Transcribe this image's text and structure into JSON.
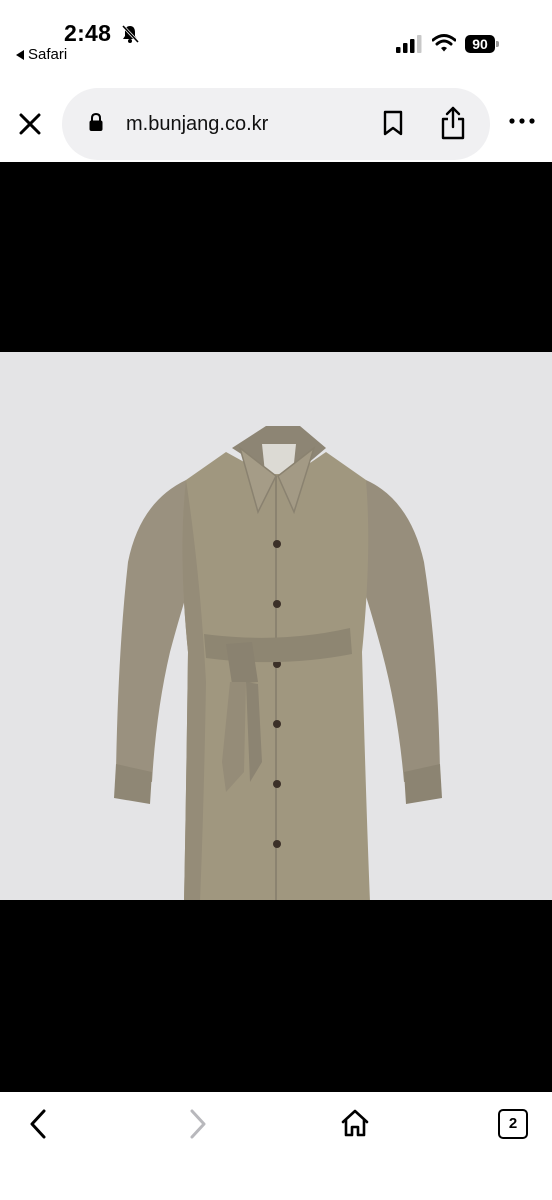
{
  "status_bar": {
    "time": "2:48",
    "back_app_label": "Safari",
    "battery_level": "90",
    "icons": [
      "bell-slash-icon",
      "signal-icon",
      "wifi-icon",
      "battery-icon"
    ]
  },
  "address_bar": {
    "url": "m.bunjang.co.kr",
    "icons": [
      "close-icon",
      "lock-icon",
      "bookmark-icon",
      "share-icon",
      "more-icon"
    ]
  },
  "content": {
    "image_subject": "taupe belted shirt dress",
    "colors": {
      "viewer_background": "#000000",
      "image_background": "#e4e4e6",
      "garment": "#9c9382"
    }
  },
  "bottom_toolbar": {
    "tab_count": "2",
    "icons": [
      "chevron-left-icon",
      "chevron-right-icon",
      "home-icon",
      "tabs-icon"
    ]
  }
}
